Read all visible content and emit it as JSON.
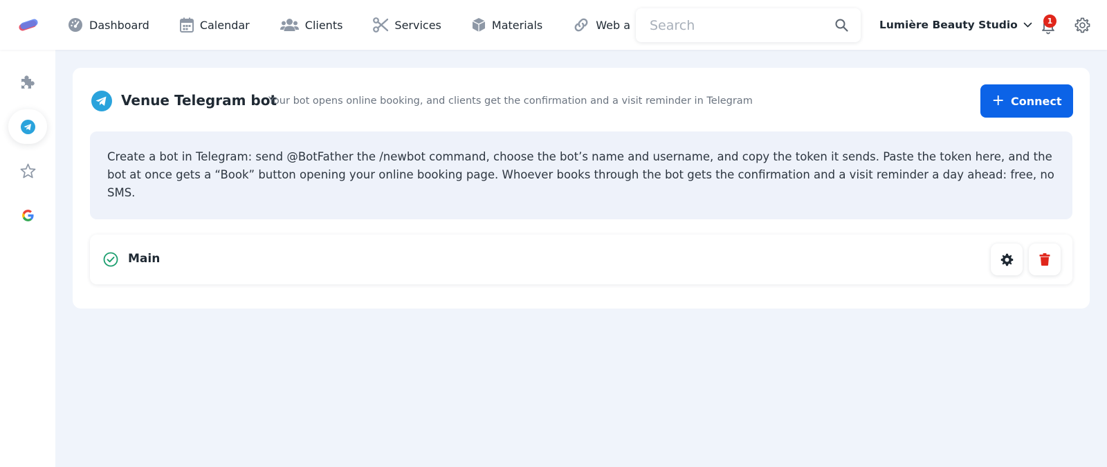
{
  "nav": {
    "items": [
      {
        "label": "Dashboard",
        "icon": "gauge-icon"
      },
      {
        "label": "Calendar",
        "icon": "calendar-icon"
      },
      {
        "label": "Clients",
        "icon": "users-icon"
      },
      {
        "label": "Services",
        "icon": "scissors-icon"
      },
      {
        "label": "Materials",
        "icon": "box-icon"
      },
      {
        "label": "Web a",
        "icon": "link-icon"
      }
    ]
  },
  "search": {
    "placeholder": "Search",
    "value": ""
  },
  "header": {
    "studio_name": "Lumière Beauty Studio",
    "notifications_count": "1"
  },
  "sidebar": {
    "items": [
      {
        "name": "integrations",
        "icon": "puzzle-icon",
        "active": false
      },
      {
        "name": "telegram",
        "icon": "telegram-icon",
        "active": true
      },
      {
        "name": "reviews",
        "icon": "star-icon",
        "active": false
      },
      {
        "name": "google",
        "icon": "google-icon",
        "active": false
      }
    ]
  },
  "card": {
    "title": "Venue Telegram bot",
    "subtitle": "Your bot opens online booking, and clients get the confirmation and a visit reminder in Telegram",
    "connect_label": "Connect",
    "info_text": "Create a bot in Telegram: send @BotFather the /newbot command, choose the bot’s name and username, and copy the token it sends. Paste the token here, and the bot at once gets a “Book” button opening your online booking page. Whoever books through the bot gets the confirmation and a visit reminder a day ahead: free, no SMS."
  },
  "bots": [
    {
      "name": "Main",
      "status": "active"
    }
  ],
  "colors": {
    "accent": "#0c63e7",
    "telegram": "#2aa3dc",
    "success": "#1b9e6e",
    "danger": "#e0261b",
    "page_bg": "#f0f4fb",
    "info_bg": "#eef2fa"
  }
}
